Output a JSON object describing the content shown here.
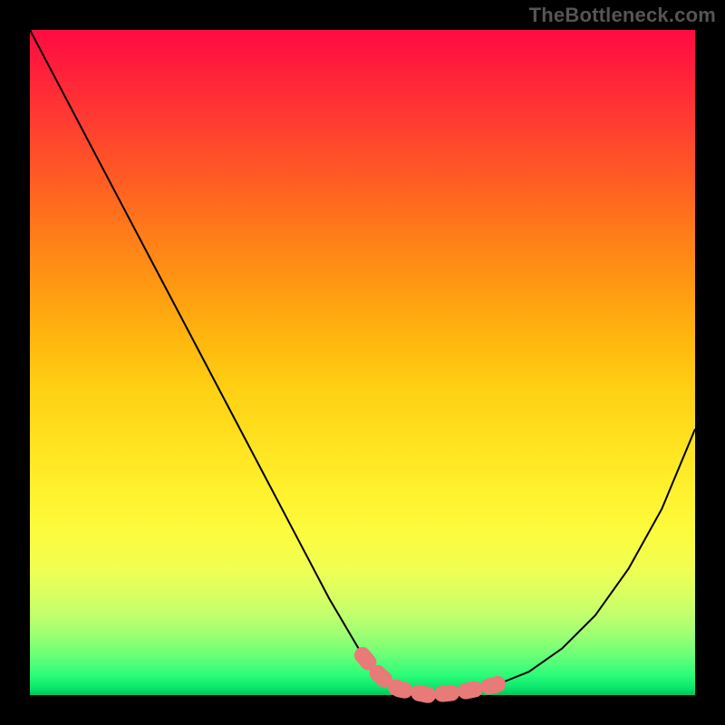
{
  "attribution": "TheBottleneck.com",
  "chart_data": {
    "type": "line",
    "title": "",
    "xlabel": "",
    "ylabel": "",
    "x": [
      0.0,
      0.05,
      0.1,
      0.15,
      0.2,
      0.25,
      0.3,
      0.35,
      0.4,
      0.45,
      0.5,
      0.525,
      0.55,
      0.6,
      0.65,
      0.7,
      0.75,
      0.8,
      0.85,
      0.9,
      0.95,
      1.0
    ],
    "values": [
      1.0,
      0.905,
      0.81,
      0.715,
      0.62,
      0.525,
      0.43,
      0.335,
      0.24,
      0.145,
      0.06,
      0.03,
      0.01,
      0.0,
      0.005,
      0.015,
      0.035,
      0.07,
      0.12,
      0.19,
      0.28,
      0.4
    ],
    "flat_region_x": [
      0.5,
      0.72
    ],
    "xlim": [
      0,
      1
    ],
    "ylim": [
      0,
      1
    ],
    "legend": [],
    "annotations": []
  }
}
